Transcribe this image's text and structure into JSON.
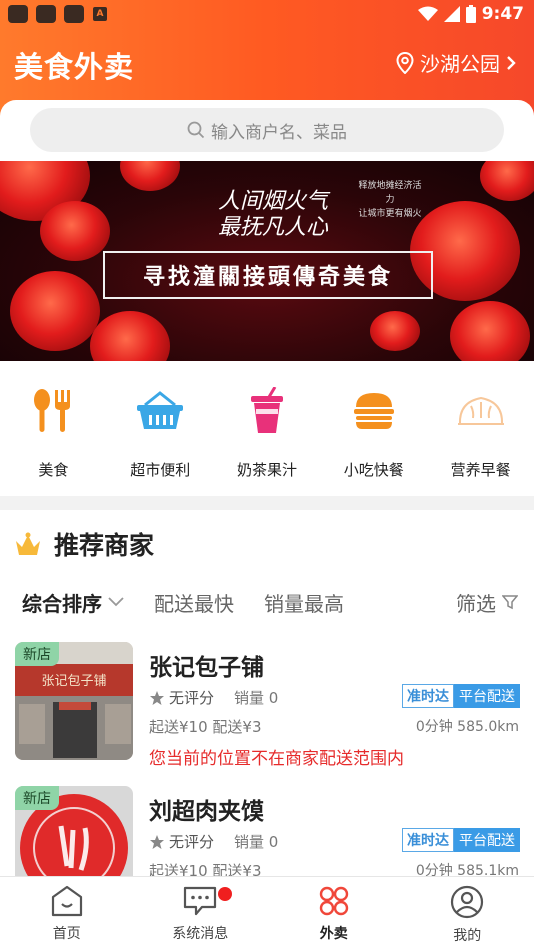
{
  "status_bar": {
    "time": "9:47",
    "badge": "A"
  },
  "header": {
    "title": "美食外卖",
    "location": "沙湖公园"
  },
  "search": {
    "placeholder": "输入商户名、菜品"
  },
  "banner": {
    "headline_1": "人间烟火气",
    "headline_2": "最抚凡人心",
    "side_1": "释放地摊经济活力",
    "side_2": "让城市更有烟火",
    "main": "寻找潼關接頭傳奇美食"
  },
  "categories": [
    {
      "label": "美食",
      "icon": "utensils-icon",
      "color": "#f4901e"
    },
    {
      "label": "超市便利",
      "icon": "basket-icon",
      "color": "#3aa7e6"
    },
    {
      "label": "奶茶果汁",
      "icon": "drink-cup-icon",
      "color": "#e8317a"
    },
    {
      "label": "小吃快餐",
      "icon": "burger-icon",
      "color": "#f4901e"
    },
    {
      "label": "营养早餐",
      "icon": "dumpling-icon",
      "color": "#f7c79a"
    }
  ],
  "section": {
    "title": "推荐商家"
  },
  "sort": {
    "active": "综合排序",
    "options": [
      "配送最快",
      "销量最高"
    ],
    "filter": "筛选"
  },
  "shops": [
    {
      "badge": "新店",
      "name": "张记包子铺",
      "rating": "无评分",
      "sales": "销量 0",
      "tag_ontime": "准时达",
      "tag_delivery": "平台配送",
      "fee": "起送¥10  配送¥3",
      "distance": "0分钟  585.0km",
      "warning": "您当前的位置不在商家配送范围内"
    },
    {
      "badge": "新店",
      "name": "刘超肉夹馍",
      "rating": "无评分",
      "sales": "销量 0",
      "tag_ontime": "准时达",
      "tag_delivery": "平台配送",
      "fee": "起送¥10  配送¥3",
      "distance": "0分钟  585.1km"
    }
  ],
  "bottom_nav": [
    {
      "label": "首页",
      "icon": "home-icon"
    },
    {
      "label": "系统消息",
      "icon": "message-icon"
    },
    {
      "label": "外卖",
      "icon": "takeout-icon",
      "active": true
    },
    {
      "label": "我的",
      "icon": "profile-icon"
    }
  ],
  "colors": {
    "brand": "#ff5a22",
    "accent_red": "#e62b2b",
    "tag_blue": "#3a9be6"
  }
}
